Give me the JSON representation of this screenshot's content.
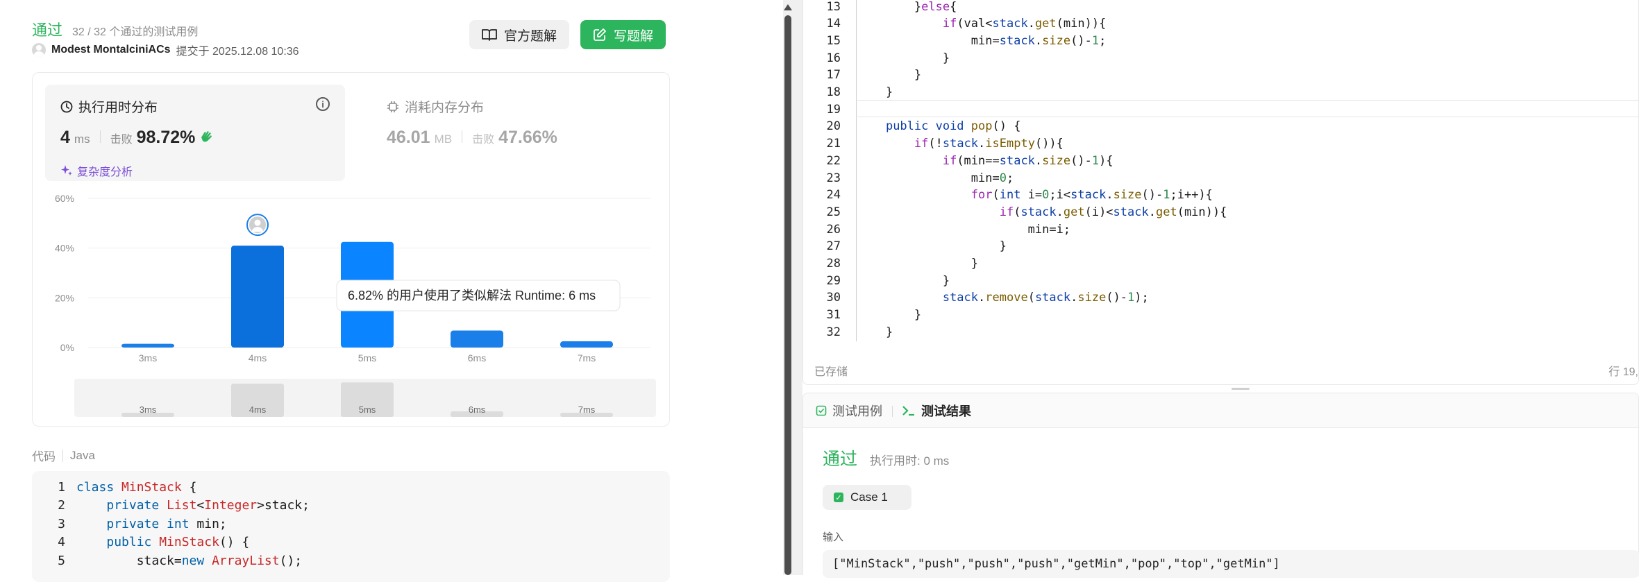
{
  "submission": {
    "status": "通过",
    "passed": "32 / 32 个通过的测试用例",
    "author": "Modest MontalciniACs",
    "submitted": "提交于 2025.12.08 10:36"
  },
  "buttons": {
    "official": "官方题解",
    "write": "写题解"
  },
  "runtime": {
    "title": "执行用时分布",
    "value": "4",
    "unit": "ms",
    "beat_label": "击败",
    "beat_value": "98.72%",
    "complexity": "复杂度分析"
  },
  "memory": {
    "title": "消耗内存分布",
    "value": "46.01",
    "unit": "MB",
    "beat_label": "击败",
    "beat_value": "47.66%"
  },
  "chart_data": {
    "type": "bar",
    "categories": [
      "3ms",
      "4ms",
      "5ms",
      "6ms",
      "7ms"
    ],
    "values": [
      1.5,
      41,
      42.5,
      6.82,
      2.5
    ],
    "ylim": [
      0,
      60
    ],
    "yticks": [
      "0%",
      "20%",
      "40%",
      "60%"
    ],
    "highlight": "4ms",
    "hovered": "5ms",
    "tooltip": "6.82% 的用户使用了类似解法 Runtime: 6 ms",
    "grid": true,
    "colors": {
      "bar": "#1a7fe8",
      "bar_active": "#0b6fdc",
      "bar_hover": "#0a84ff",
      "mini": "#dcdcdc"
    },
    "overview_values": [
      1.5,
      41,
      42.5,
      6.82,
      2.5
    ]
  },
  "code_section": {
    "label": "代码",
    "lang": "Java",
    "lines": [
      {
        "n": "1",
        "parts": [
          [
            "kwp",
            "class "
          ],
          [
            "ty",
            "MinStack"
          ],
          [
            "var",
            " {"
          ]
        ]
      },
      {
        "n": "2",
        "parts": [
          [
            "var",
            "    "
          ],
          [
            "kwp",
            "private "
          ],
          [
            "ty",
            "List"
          ],
          [
            "var",
            "<"
          ],
          [
            "ty",
            "Integer"
          ],
          [
            "var",
            ">stack;"
          ]
        ]
      },
      {
        "n": "3",
        "parts": [
          [
            "var",
            "    "
          ],
          [
            "kwp",
            "private int "
          ],
          [
            "var",
            "min;"
          ]
        ]
      },
      {
        "n": "4",
        "parts": [
          [
            "var",
            "    "
          ],
          [
            "kwp",
            "public "
          ],
          [
            "ty",
            "MinStack"
          ],
          [
            "var",
            "() {"
          ]
        ]
      },
      {
        "n": "5",
        "parts": [
          [
            "var",
            "        stack="
          ],
          [
            "kwp",
            "new "
          ],
          [
            "ty",
            "ArrayList"
          ],
          [
            "var",
            "();"
          ]
        ]
      }
    ]
  },
  "editor": {
    "lines": [
      {
        "n": "13",
        "parts": [
          [
            "var",
            "        }"
          ],
          [
            "kw2",
            "else"
          ],
          [
            "var",
            "{"
          ]
        ]
      },
      {
        "n": "14",
        "parts": [
          [
            "var",
            "            "
          ],
          [
            "kw2",
            "if"
          ],
          [
            "var",
            "(val<"
          ],
          [
            "kw",
            "stack"
          ],
          [
            "var",
            "."
          ],
          [
            "tf",
            "get"
          ],
          [
            "var",
            "(min)){"
          ]
        ]
      },
      {
        "n": "15",
        "parts": [
          [
            "var",
            "                min="
          ],
          [
            "kw",
            "stack"
          ],
          [
            "var",
            "."
          ],
          [
            "tf",
            "size"
          ],
          [
            "var",
            "()-"
          ],
          [
            "num",
            "1"
          ],
          [
            "var",
            ";"
          ]
        ]
      },
      {
        "n": "16",
        "parts": [
          [
            "var",
            "            }"
          ]
        ]
      },
      {
        "n": "17",
        "parts": [
          [
            "var",
            "        }"
          ]
        ]
      },
      {
        "n": "18",
        "parts": [
          [
            "var",
            "    }"
          ]
        ]
      },
      {
        "n": "19",
        "parts": [
          [
            "var",
            ""
          ]
        ]
      },
      {
        "n": "20",
        "parts": [
          [
            "var",
            "    "
          ],
          [
            "kw",
            "public void "
          ],
          [
            "tf",
            "pop"
          ],
          [
            "var",
            "() {"
          ]
        ]
      },
      {
        "n": "21",
        "parts": [
          [
            "var",
            "        "
          ],
          [
            "kw2",
            "if"
          ],
          [
            "var",
            "(!"
          ],
          [
            "kw",
            "stack"
          ],
          [
            "var",
            "."
          ],
          [
            "tf",
            "isEmpty"
          ],
          [
            "var",
            "()){"
          ]
        ]
      },
      {
        "n": "22",
        "parts": [
          [
            "var",
            "            "
          ],
          [
            "kw2",
            "if"
          ],
          [
            "var",
            "(min=="
          ],
          [
            "kw",
            "stack"
          ],
          [
            "var",
            "."
          ],
          [
            "tf",
            "size"
          ],
          [
            "var",
            "()-"
          ],
          [
            "num",
            "1"
          ],
          [
            "var",
            "){"
          ]
        ]
      },
      {
        "n": "23",
        "parts": [
          [
            "var",
            "                min="
          ],
          [
            "num",
            "0"
          ],
          [
            "var",
            ";"
          ]
        ]
      },
      {
        "n": "24",
        "parts": [
          [
            "var",
            "                "
          ],
          [
            "kw2",
            "for"
          ],
          [
            "var",
            "("
          ],
          [
            "kw",
            "int "
          ],
          [
            "var",
            "i="
          ],
          [
            "num",
            "0"
          ],
          [
            "var",
            ";i<"
          ],
          [
            "kw",
            "stack"
          ],
          [
            "var",
            "."
          ],
          [
            "tf",
            "size"
          ],
          [
            "var",
            "()-"
          ],
          [
            "num",
            "1"
          ],
          [
            "var",
            ";i++){"
          ]
        ]
      },
      {
        "n": "25",
        "parts": [
          [
            "var",
            "                    "
          ],
          [
            "kw2",
            "if"
          ],
          [
            "var",
            "("
          ],
          [
            "kw",
            "stack"
          ],
          [
            "var",
            "."
          ],
          [
            "tf",
            "get"
          ],
          [
            "var",
            "(i)<"
          ],
          [
            "kw",
            "stack"
          ],
          [
            "var",
            "."
          ],
          [
            "tf",
            "get"
          ],
          [
            "var",
            "(min)){"
          ]
        ]
      },
      {
        "n": "26",
        "parts": [
          [
            "var",
            "                        min=i;"
          ]
        ]
      },
      {
        "n": "27",
        "parts": [
          [
            "var",
            "                    }"
          ]
        ]
      },
      {
        "n": "28",
        "parts": [
          [
            "var",
            "                }"
          ]
        ]
      },
      {
        "n": "29",
        "parts": [
          [
            "var",
            "            }"
          ]
        ]
      },
      {
        "n": "30",
        "parts": [
          [
            "var",
            "            "
          ],
          [
            "kw",
            "stack"
          ],
          [
            "var",
            "."
          ],
          [
            "tf",
            "remove"
          ],
          [
            "var",
            "("
          ],
          [
            "kw",
            "stack"
          ],
          [
            "var",
            "."
          ],
          [
            "tf",
            "size"
          ],
          [
            "var",
            "()-"
          ],
          [
            "num",
            "1"
          ],
          [
            "var",
            ");"
          ]
        ]
      },
      {
        "n": "31",
        "parts": [
          [
            "var",
            "        }"
          ]
        ]
      },
      {
        "n": "32",
        "parts": [
          [
            "var",
            "    }"
          ]
        ]
      }
    ],
    "saved": "已存储",
    "position": "行 19,"
  },
  "test_pane": {
    "tab_cases": "测试用例",
    "tab_results": "测试结果",
    "status": "通过",
    "exec_time": "执行用时: 0 ms",
    "case_label": "Case 1",
    "input_label": "输入",
    "input_value": "[\"MinStack\",\"push\",\"push\",\"push\",\"getMin\",\"pop\",\"top\",\"getMin\"]"
  }
}
